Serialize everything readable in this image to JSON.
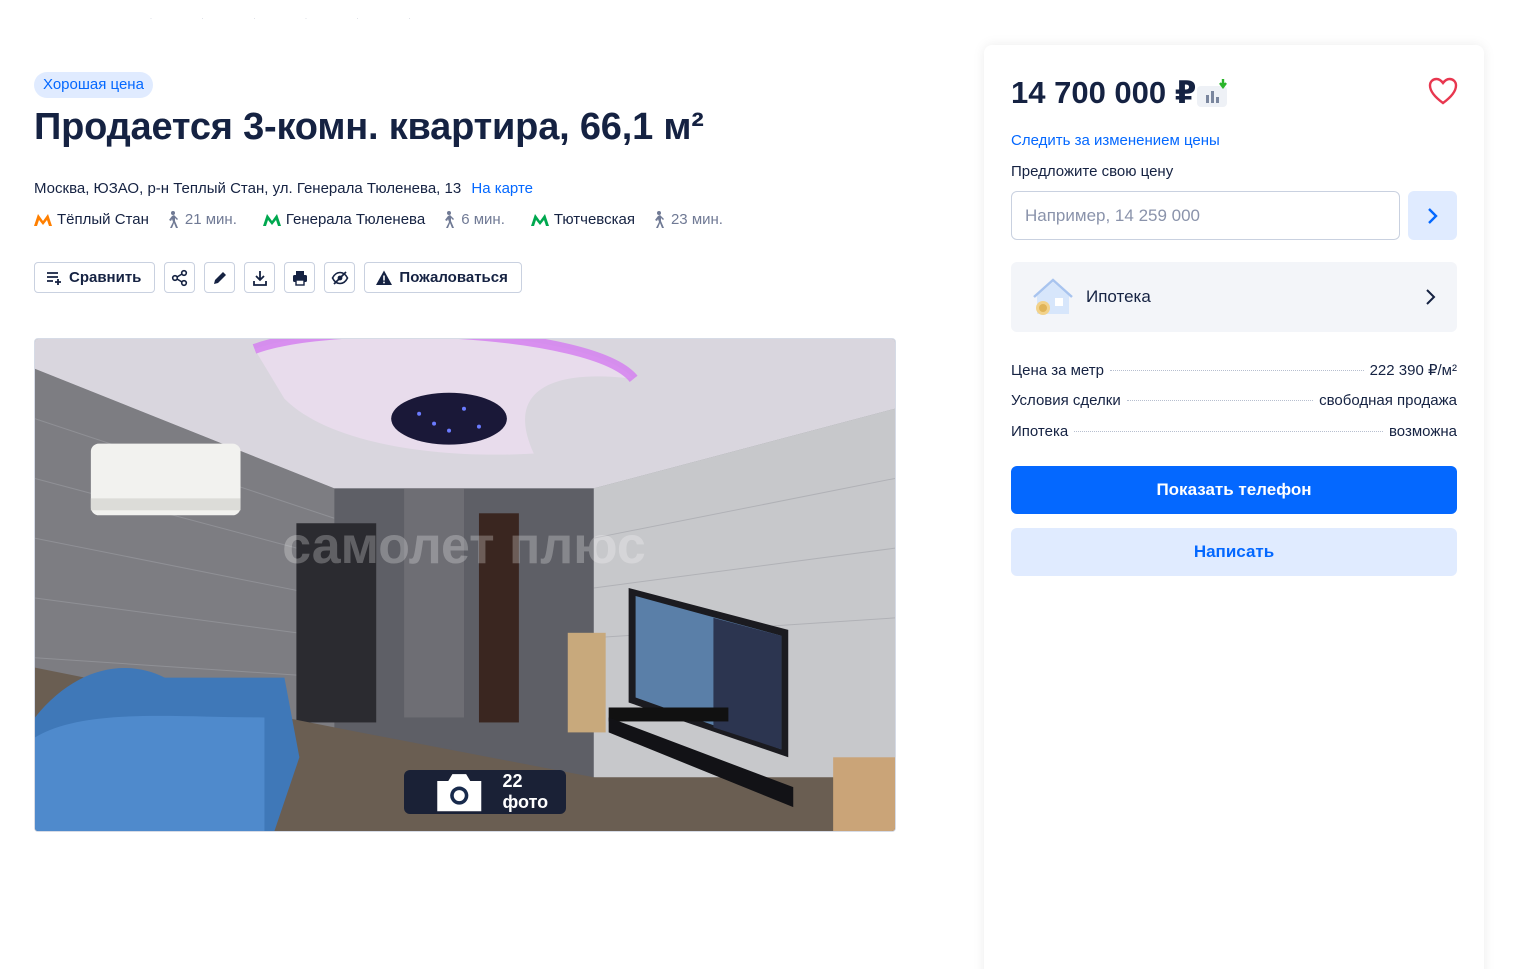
{
  "listing": {
    "badge": "Хорошая цена",
    "title": "Продается 3-комн. квартира, 66,1 м²",
    "address": "Москва, ЮЗАО, р-н Теплый Стан, ул. Генерала Тюленева, 13",
    "map_link": "На карте",
    "metro": [
      {
        "station": "Тёплый Стан",
        "time": "21 мин.",
        "color": "#ff7f00"
      },
      {
        "station": "Генерала Тюленева",
        "time": "6 мин.",
        "color": "#00a84f"
      },
      {
        "station": "Тютчевская",
        "time": "23 мин.",
        "color": "#00a84f"
      }
    ],
    "actions": {
      "compare": "Сравнить",
      "complain": "Пожаловаться",
      "icons": [
        "share-icon",
        "edit-icon",
        "download-icon",
        "print-icon",
        "hide-icon"
      ]
    },
    "gallery": {
      "photo_count": "22 фото",
      "watermark": "самолет плюс"
    }
  },
  "sidebar": {
    "price": "14 700 000 ₽",
    "follow_price": "Следить за изменением цены",
    "offer_label": "Предложите свою цену",
    "offer_placeholder": "Например, 14 259 000",
    "mortgage_label": "Ипотека",
    "facts": [
      {
        "label": "Цена за метр",
        "value": "222 390 ₽/м²"
      },
      {
        "label": "Условия сделки",
        "value": "свободная продажа"
      },
      {
        "label": "Ипотека",
        "value": "возможна"
      }
    ],
    "show_phone": "Показать телефон",
    "write": "Написать"
  },
  "colors": {
    "accent": "#0468ff",
    "accent_light": "#e0ebff",
    "text": "#152242",
    "favorite": "#e8374f"
  }
}
